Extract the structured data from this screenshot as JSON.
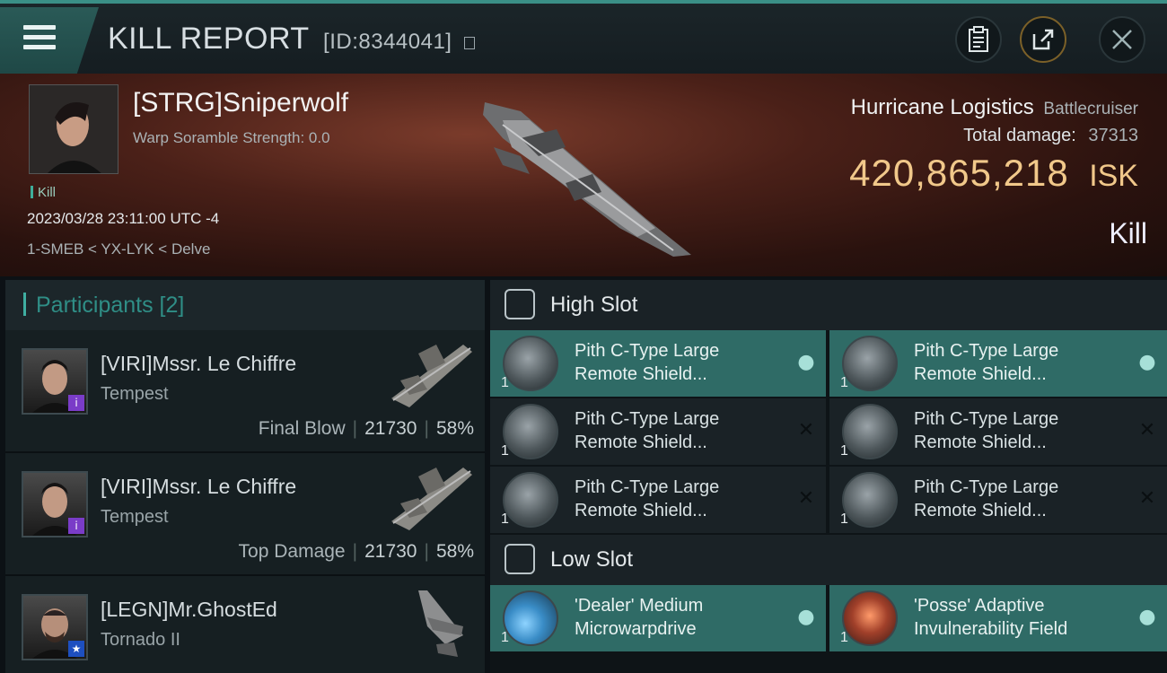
{
  "header": {
    "title": "KILL REPORT",
    "id_text": "[ID:8344041]",
    "buttons": [
      "clipboard-icon",
      "share-icon",
      "close-icon"
    ]
  },
  "victim": {
    "name": "[STRG]Sniperwolf",
    "scramble": "Warp Soramble Strength: 0.0",
    "kill_label": "Kill",
    "date": "2023/03/28 23:11:00 UTC -4",
    "location": "1-SMEB < YX-LYK < Delve"
  },
  "ship": {
    "name": "Hurricane Logistics",
    "class": "Battlecruiser",
    "total_damage_label": "Total damage:",
    "total_damage": "37313",
    "isk_value": "420,865,218",
    "isk_unit": "ISK",
    "result": "Kill"
  },
  "participants": {
    "header": "Participants [2]",
    "items": [
      {
        "name": "[VIRI]Mssr. Le Chiffre",
        "ship": "Tempest",
        "label": "Final Blow",
        "damage": "21730",
        "percent": "58%"
      },
      {
        "name": "[VIRI]Mssr. Le Chiffre",
        "ship": "Tempest",
        "label": "Top Damage",
        "damage": "21730",
        "percent": "58%"
      },
      {
        "name": "[LEGN]Mr.GhostEd",
        "ship": "Tornado II"
      }
    ]
  },
  "slots": {
    "high": {
      "title": "High Slot",
      "modules": [
        {
          "line1": "Pith C-Type Large",
          "line2": "Remote Shield...",
          "qty": "1"
        },
        {
          "line1": "Pith C-Type Large",
          "line2": "Remote Shield...",
          "qty": "1"
        },
        {
          "line1": "Pith C-Type Large",
          "line2": "Remote Shield...",
          "qty": "1"
        },
        {
          "line1": "Pith C-Type Large",
          "line2": "Remote Shield...",
          "qty": "1"
        },
        {
          "line1": "Pith C-Type Large",
          "line2": "Remote Shield...",
          "qty": "1"
        },
        {
          "line1": "Pith C-Type Large",
          "line2": "Remote Shield...",
          "qty": "1"
        }
      ]
    },
    "low": {
      "title": "Low Slot",
      "modules": [
        {
          "line1": "'Dealer' Medium",
          "line2": "Microwarpdrive",
          "qty": "1"
        },
        {
          "line1": "'Posse' Adaptive",
          "line2": "Invulnerability Field",
          "qty": "1"
        }
      ]
    }
  },
  "colors": {
    "accent": "#3faea1",
    "isk": "#f1c88a",
    "fitted": "#2f6b66"
  }
}
